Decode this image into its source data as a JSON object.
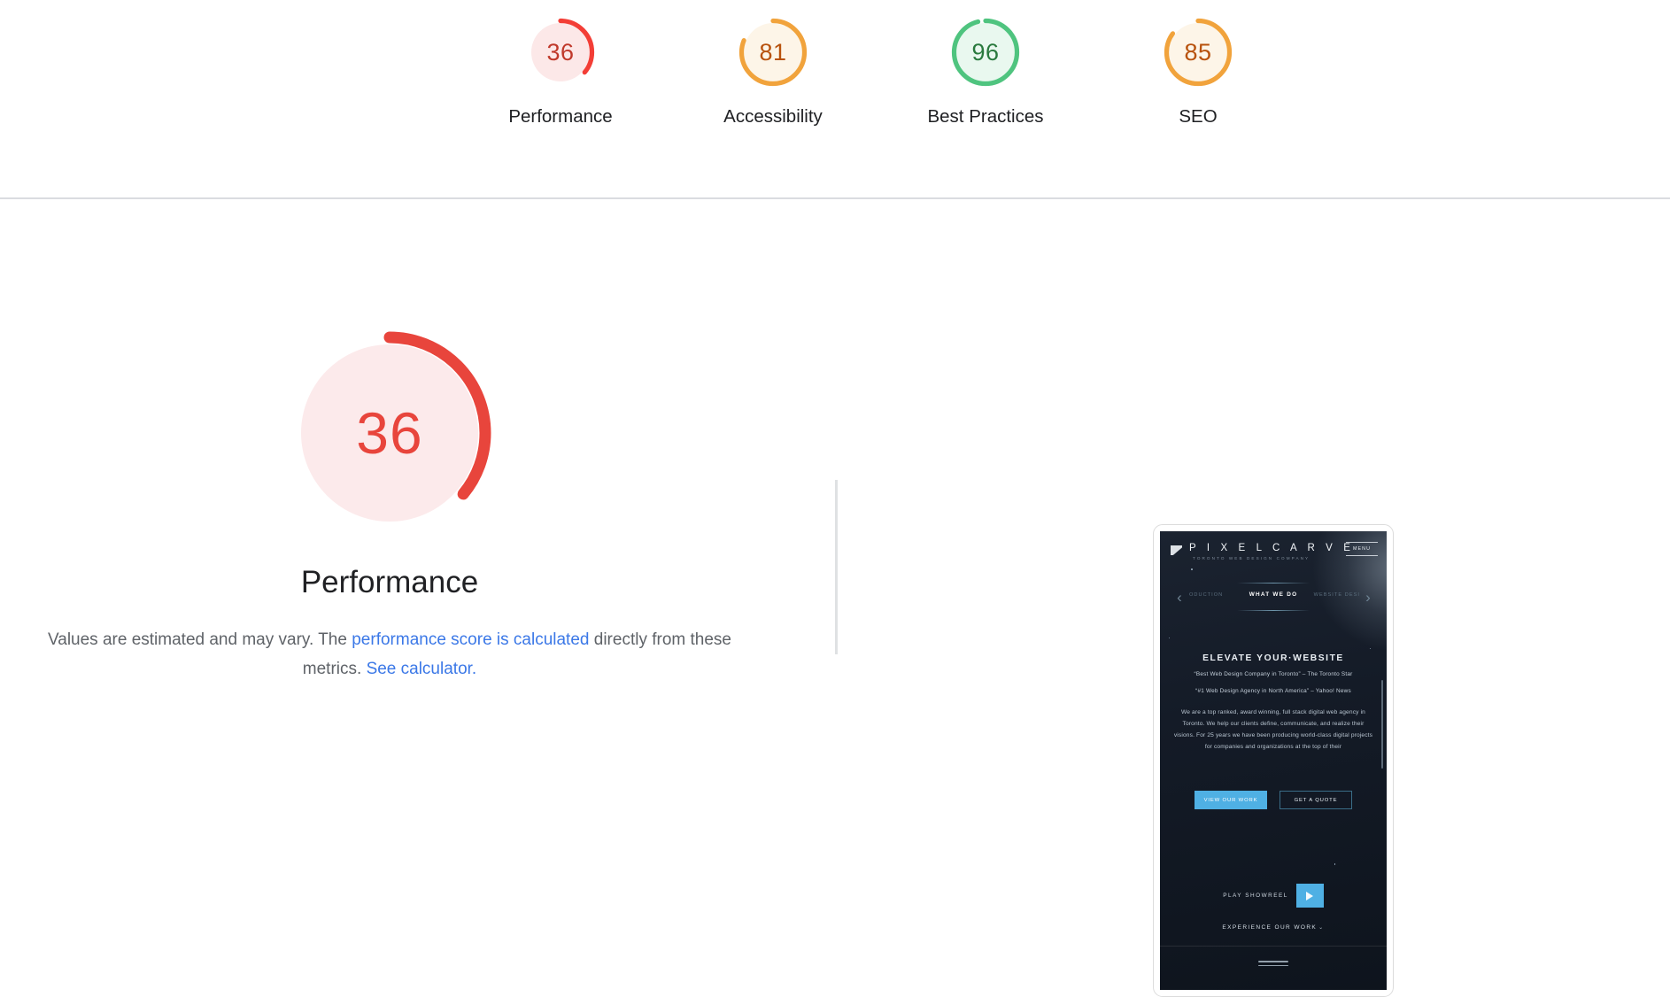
{
  "page": {
    "background_color": "#ffffff"
  },
  "score_summary": {
    "gauges": [
      {
        "label": "Performance",
        "value": "36",
        "score": 36,
        "arc_color": "#f33e36",
        "track_color": "#fce8e8",
        "text_color": "#c0392b",
        "rating": "fail"
      },
      {
        "label": "Accessibility",
        "value": "81",
        "score": 81,
        "arc_color": "#f1a33c",
        "track_color": "#fdf5e8",
        "text_color": "#b8520d",
        "rating": "average"
      },
      {
        "label": "Best Practices",
        "value": "96",
        "score": 96,
        "arc_color": "#4fc47f",
        "track_color": "#e9f8ef",
        "text_color": "#2a7a3e",
        "rating": "pass"
      },
      {
        "label": "SEO",
        "value": "85",
        "score": 85,
        "arc_color": "#f1a33c",
        "track_color": "#fdf5e8",
        "text_color": "#b8520d",
        "rating": "average"
      }
    ]
  },
  "category": {
    "gauge": {
      "value": "36",
      "score": 36,
      "arc_color": "#e8453c",
      "track_color": "#fceaeb",
      "text_color": "#e8453c"
    },
    "title": "Performance",
    "note": {
      "text_before": "Values are estimated and may vary. The ",
      "link_1": "performance score is calculated",
      "text_middle": " directly from these metrics. ",
      "link_2": "See calculator.",
      "link_color": "#3b78e7"
    }
  },
  "screenshot": {
    "site": {
      "brand_name": "P I X E L C A R V E",
      "brand_tagline": "TORONTO WEB DESIGN COMPANY",
      "menu_label": "MENU",
      "nav": {
        "prev_arrow": "‹",
        "next_arrow": "›",
        "item_prev": "ODUCTION",
        "item_active": "WHAT WE DO",
        "item_next": "WEBSITE DESI"
      },
      "hero": {
        "heading": "ELEVATE YOUR·WEBSITE",
        "quote_1": "“Best Web Design Company in Toronto” – The Toronto Star",
        "quote_2": "“#1 Web Design Agency in North America” – Yahoo! News",
        "body": "We are a top ranked, award winning, full stack digital web agency in Toronto. We help our clients define, communicate, and realize their visions. For 25 years we have been producing world-class digital projects for companies and organizations at the top of their"
      },
      "cta": {
        "primary": "VIEW OUR WORK",
        "secondary": "GET A QUOTE",
        "primary_color": "#4fb0e4"
      },
      "showreel": {
        "label": "PLAY SHOWREEL",
        "play_icon": "play-triangle-icon"
      },
      "experience": {
        "label": "EXPERIENCE OUR WORK",
        "chevron": "⌄"
      }
    }
  }
}
